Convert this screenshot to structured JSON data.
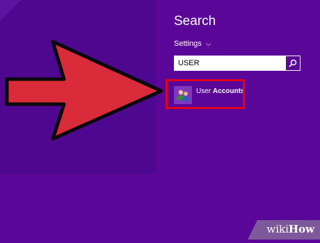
{
  "charms": {
    "title": "Search",
    "scope_label": "Settings",
    "scope_chevron": "⌵",
    "query": "USER",
    "search_button_icon": "magnifier-icon"
  },
  "results": [
    {
      "label_normal": "User",
      "label_bold": "Accounts",
      "icon": "user-accounts-icon"
    }
  ],
  "annotation": {
    "arrow_color": "#d92b3a",
    "highlight_color": "#e3001b"
  },
  "colors": {
    "background": "#5a0799",
    "start_area": "#4e078f"
  },
  "watermark": {
    "wiki": "wiki",
    "how": "How"
  }
}
